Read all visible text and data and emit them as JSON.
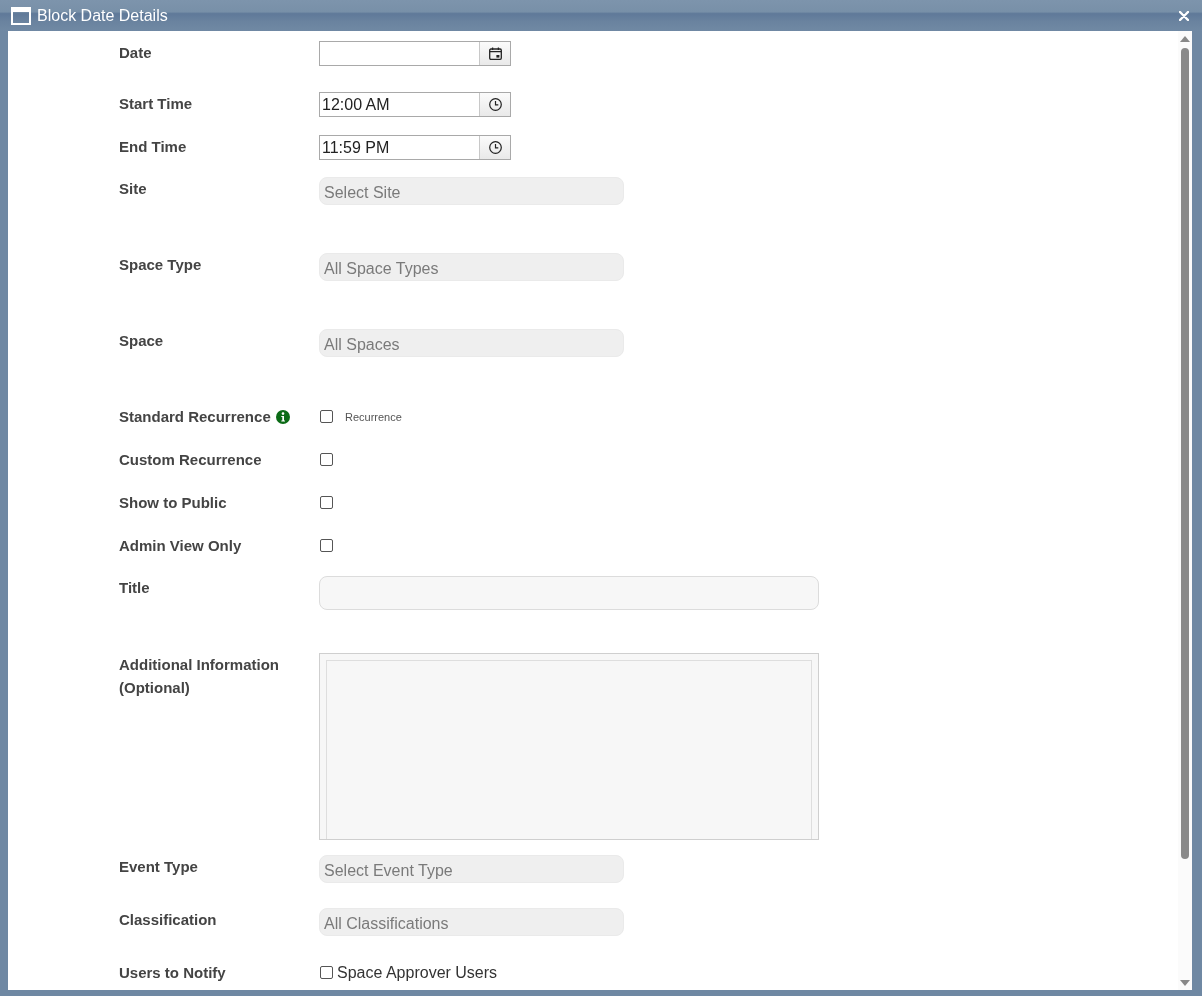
{
  "window": {
    "title": "Block Date Details"
  },
  "fields": [
    {
      "kind": "date",
      "label": "Date"
    },
    {
      "kind": "time",
      "label": "Start Time",
      "value": "12:00 AM"
    },
    {
      "kind": "time",
      "label": "End Time",
      "value": "11:59 PM"
    },
    {
      "kind": "select",
      "label": "Site",
      "placeholder": "Select Site"
    },
    {
      "kind": "select",
      "label": "Space Type",
      "placeholder": "All Space Types"
    },
    {
      "kind": "select",
      "label": "Space",
      "placeholder": "All Spaces"
    },
    {
      "kind": "checkbox",
      "label": "Standard Recurrence",
      "info": true,
      "checked": false,
      "option": "Recurrence"
    },
    {
      "kind": "checkbox",
      "label": "Custom Recurrence",
      "checked": false
    },
    {
      "kind": "checkbox",
      "label": "Show to Public",
      "checked": false
    },
    {
      "kind": "checkbox",
      "label": "Admin View Only",
      "checked": false
    },
    {
      "kind": "text",
      "label": "Title"
    },
    {
      "kind": "textarea",
      "label": "Additional Information (Optional)"
    },
    {
      "kind": "select",
      "label": "Event Type",
      "placeholder": "Select Event Type"
    },
    {
      "kind": "select",
      "label": "Classification",
      "placeholder": "All Classifications"
    },
    {
      "kind": "option",
      "label": "Users to Notify",
      "checked": false,
      "option": "Space Approver Users"
    }
  ]
}
